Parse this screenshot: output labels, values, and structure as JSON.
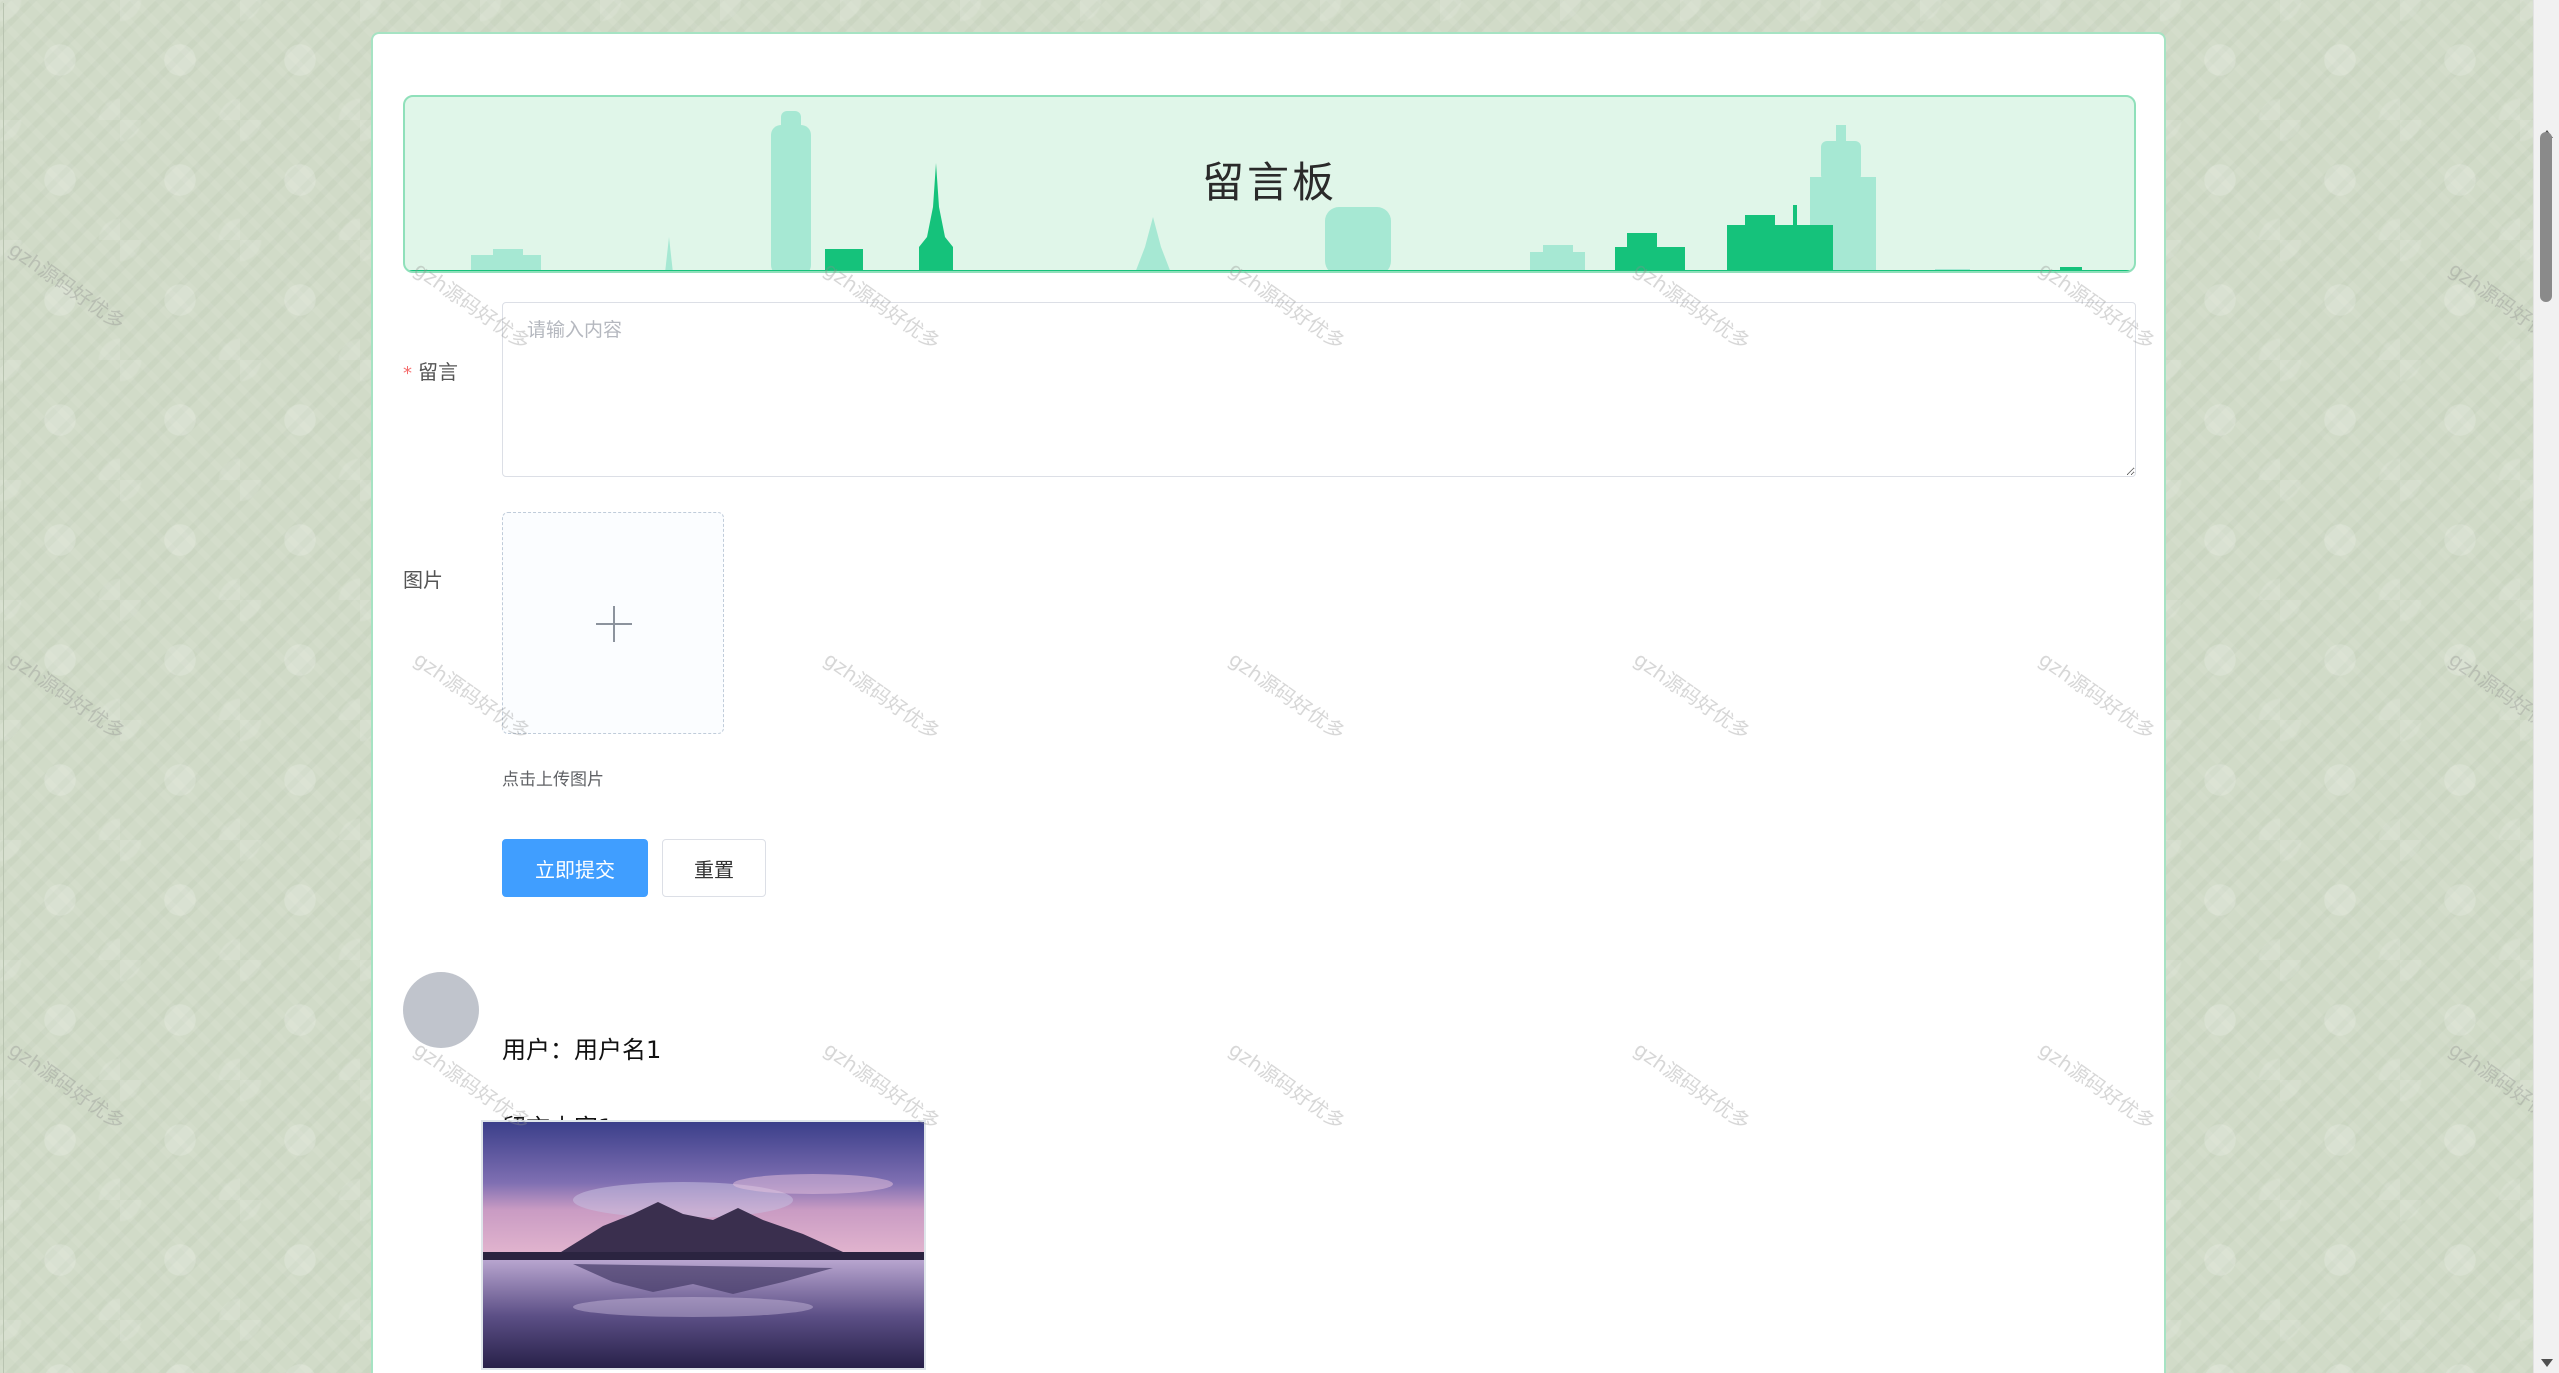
{
  "banner": {
    "title": "留言板"
  },
  "form": {
    "message_label": "留言",
    "required_mark": "*",
    "message_placeholder": "请输入内容",
    "message_value": "",
    "image_label": "图片",
    "upload_tip": "点击上传图片",
    "submit_label": "立即提交",
    "reset_label": "重置"
  },
  "comments": [
    {
      "user_text": "用户：用户名1",
      "content": "留言内容1"
    }
  ],
  "watermark": "gzh源码好优多",
  "colors": {
    "primary": "#409eff",
    "banner_bg": "#e0f6e9",
    "skyline_green": "#15c27b",
    "skyline_light": "#a6e8d3",
    "required": "#f56c6c"
  },
  "icons": {
    "upload": "plus-icon"
  }
}
